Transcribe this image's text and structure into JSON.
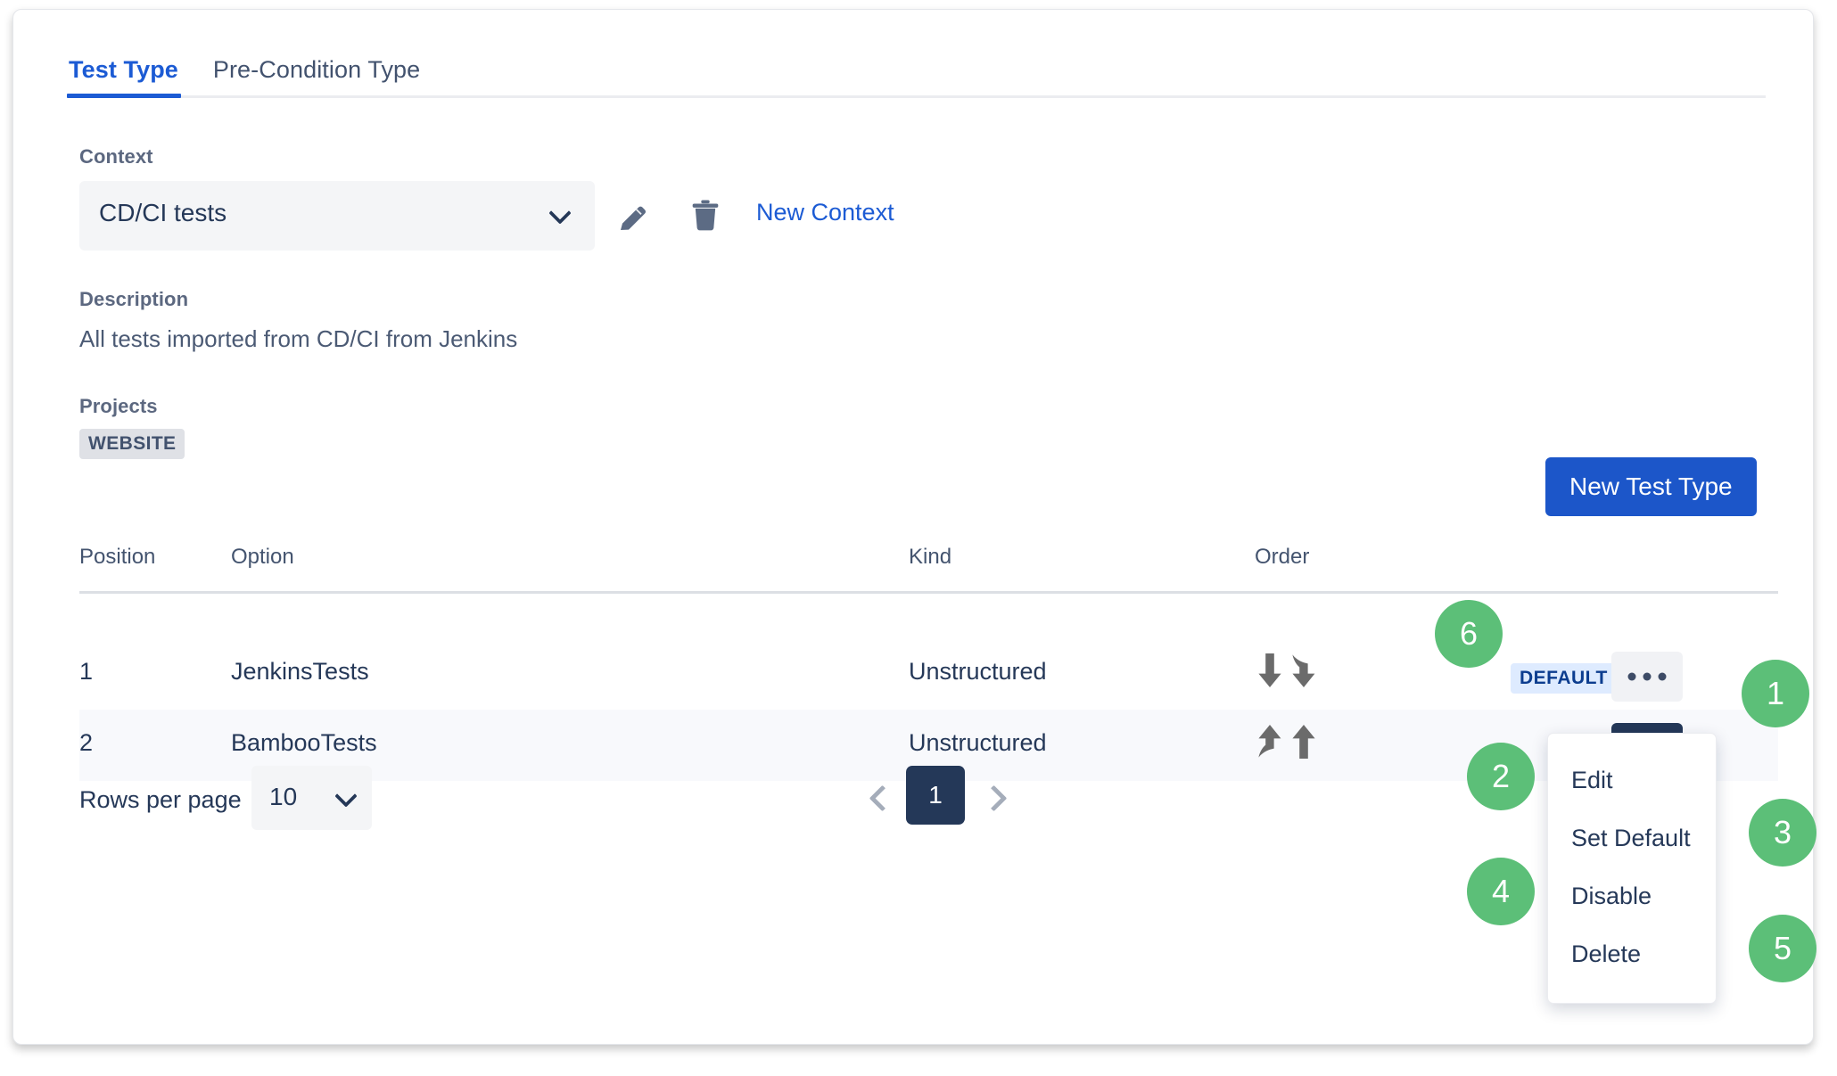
{
  "tabs": [
    {
      "label": "Test Type",
      "active": true
    },
    {
      "label": "Pre-Condition Type",
      "active": false
    }
  ],
  "context": {
    "label": "Context",
    "selected_value": "CD/CI tests",
    "edit_icon": "pencil-icon",
    "delete_icon": "trash-icon",
    "new_context_link": "New Context"
  },
  "description": {
    "label": "Description",
    "text": "All tests imported from CD/CI from Jenkins"
  },
  "projects": {
    "label": "Projects",
    "badges": [
      "WEBSITE"
    ]
  },
  "actions": {
    "new_test_type": "New Test Type"
  },
  "table": {
    "headers": {
      "position": "Position",
      "option": "Option",
      "kind": "Kind",
      "order": "Order"
    },
    "rows": [
      {
        "position": "1",
        "option": "JenkinsTests",
        "kind": "Unstructured",
        "order_icons": [
          "arrow-down-icon",
          "arrow-down-curved-icon"
        ],
        "badge": "DEFAULT",
        "kebab": "more-options-icon"
      },
      {
        "position": "2",
        "option": "BambooTests",
        "kind": "Unstructured",
        "order_icons": [
          "arrow-up-curved-icon",
          "arrow-up-icon"
        ],
        "badge": "",
        "kebab": "more-options-icon"
      }
    ]
  },
  "action_menu": {
    "items": [
      "Edit",
      "Set Default",
      "Disable",
      "Delete"
    ]
  },
  "pagination": {
    "rows_per_page_label": "Rows per page",
    "rows_per_page_value": "10",
    "prev_icon": "chevron-left-icon",
    "next_icon": "chevron-right-icon",
    "current_page": "1"
  },
  "annotations": [
    {
      "id": "1",
      "number": "1"
    },
    {
      "id": "2",
      "number": "2"
    },
    {
      "id": "3",
      "number": "3"
    },
    {
      "id": "4",
      "number": "4"
    },
    {
      "id": "5",
      "number": "5"
    },
    {
      "id": "6",
      "number": "6"
    }
  ],
  "colors": {
    "accent_blue": "#1c5bd4",
    "button_blue": "#1c56c9",
    "dark_navy": "#243858",
    "annotation_green": "#5cbf78",
    "badge_blue_bg": "#deebff",
    "badge_blue_text": "#0c3d8f",
    "badge_gray_bg": "#dfe1e6",
    "row_alt_bg": "#f8f9fc",
    "field_bg": "#f4f5f7"
  }
}
